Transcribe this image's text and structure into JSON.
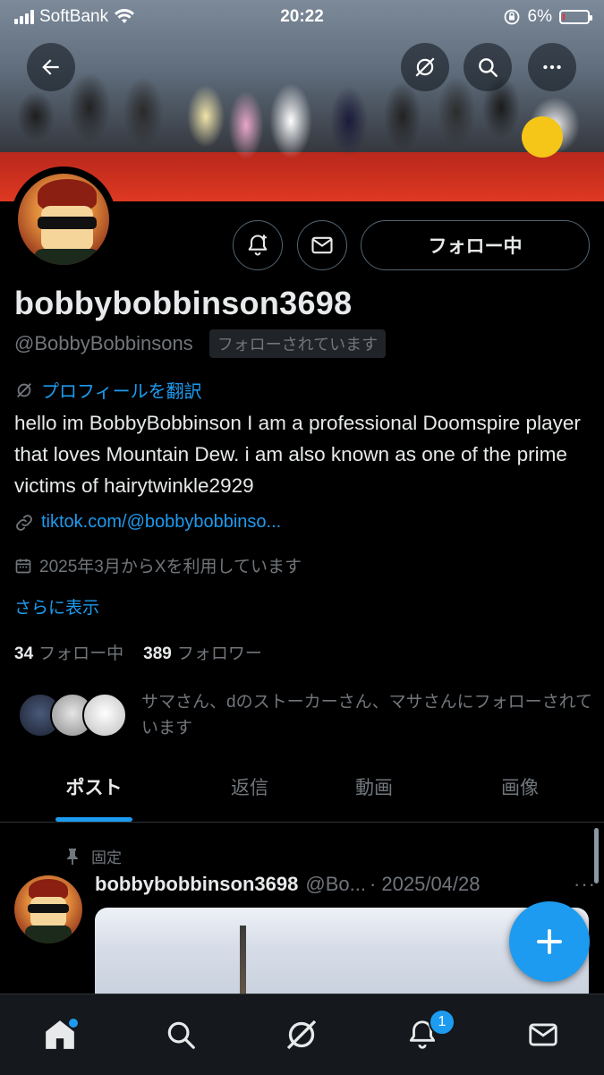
{
  "status_bar": {
    "carrier": "SoftBank",
    "time": "20:22",
    "battery": "6%",
    "battery_level": 0.06
  },
  "header": {
    "back_icon": "arrow-left-icon",
    "grok_icon": "grok-icon",
    "search_icon": "search-icon",
    "more_icon": "more-horizontal-icon"
  },
  "profile": {
    "display_name": "bobbybobbinson3698",
    "handle": "@BobbyBobbinsons",
    "follows_you": "フォローされています",
    "translate_label": "プロフィールを翻訳",
    "bio": "hello im BobbyBobbinson I am a professional Doomspire player that loves Mountain Dew. i am also known as one of the prime victims of hairytwinkle2929",
    "link": "tiktok.com/@bobbybobbinso...",
    "joined": "2025年3月からXを利用しています",
    "show_more": "さらに表示",
    "following_count": "34",
    "following_label": "フォロー中",
    "followers_count": "389",
    "followers_label": "フォロワー",
    "mutuals_text": "サマさん、dのストーカーさん、マサさんにフォローされています"
  },
  "actions": {
    "notify_icon": "bell-plus-icon",
    "message_icon": "mail-icon",
    "follow_label": "フォロー中"
  },
  "tabs": [
    {
      "label": "ポスト",
      "active": true
    },
    {
      "label": "返信",
      "active": false
    },
    {
      "label": "動画",
      "active": false
    },
    {
      "label": "画像",
      "active": false
    }
  ],
  "pinned_post": {
    "pinned_label": "固定",
    "author": "bobbybobbinson3698",
    "handle": "@Bo...",
    "date": "· 2025/04/28",
    "more": "···"
  },
  "bottom_nav": {
    "items": [
      "home-icon",
      "search-icon",
      "grok-icon",
      "bell-icon",
      "mail-icon"
    ],
    "notification_badge": "1"
  },
  "colors": {
    "accent": "#1d9bf0",
    "background": "#000000",
    "secondary_text": "#71767b"
  }
}
